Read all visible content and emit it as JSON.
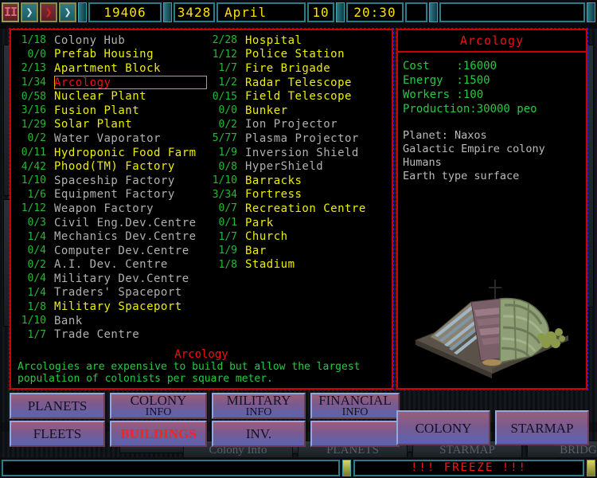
{
  "header": {
    "pause_label": "II",
    "arrow1": "❯",
    "arrow2": "❯",
    "arrow3": "❯",
    "credits": "19406",
    "year": "3428",
    "month": "April",
    "day": "10",
    "clock": "20:30"
  },
  "buildings": {
    "column_a": [
      {
        "count": "1/18",
        "name": "Colony Hub",
        "state": "grey"
      },
      {
        "count": "0/0",
        "name": "Prefab Housing",
        "state": "yellow"
      },
      {
        "count": "2/13",
        "name": "Apartment Block",
        "state": "yellow"
      },
      {
        "count": "1/34",
        "name": "Arcology",
        "state": "sel"
      },
      {
        "count": "0/58",
        "name": "Nuclear Plant",
        "state": "yellow"
      },
      {
        "count": "3/16",
        "name": "Fusion Plant",
        "state": "yellow"
      },
      {
        "count": "1/29",
        "name": "Solar Plant",
        "state": "yellow"
      },
      {
        "count": "0/2",
        "name": "Water Vaporator",
        "state": "grey"
      },
      {
        "count": "0/11",
        "name": "Hydroponic Food Farm",
        "state": "yellow"
      },
      {
        "count": "4/42",
        "name": "Phood(TM) Factory",
        "state": "yellow"
      },
      {
        "count": "1/10",
        "name": "Spaceship Factory",
        "state": "grey"
      },
      {
        "count": "1/6",
        "name": "Equipment Factory",
        "state": "grey"
      },
      {
        "count": "1/12",
        "name": "Weapon Factory",
        "state": "grey"
      },
      {
        "count": "0/3",
        "name": "Civil Eng.Dev.Centre",
        "state": "grey"
      },
      {
        "count": "1/4",
        "name": "Mechanics Dev.Centre",
        "state": "grey"
      },
      {
        "count": "0/4",
        "name": "Computer Dev.Centre",
        "state": "grey"
      },
      {
        "count": "0/2",
        "name": "A.I. Dev. Centre",
        "state": "grey"
      },
      {
        "count": "0/4",
        "name": "Military Dev.Centre",
        "state": "grey"
      },
      {
        "count": "1/4",
        "name": "Traders' Spaceport",
        "state": "grey"
      },
      {
        "count": "1/8",
        "name": "Military Spaceport",
        "state": "yellow"
      },
      {
        "count": "1/10",
        "name": "Bank",
        "state": "grey"
      },
      {
        "count": "1/7",
        "name": "Trade Centre",
        "state": "grey"
      }
    ],
    "column_b": [
      {
        "count": "2/28",
        "name": "Hospital",
        "state": "yellow"
      },
      {
        "count": "1/12",
        "name": "Police Station",
        "state": "yellow"
      },
      {
        "count": "1/7",
        "name": "Fire Brigade",
        "state": "yellow"
      },
      {
        "count": "1/2",
        "name": "Radar Telescope",
        "state": "yellow"
      },
      {
        "count": "0/15",
        "name": "Field Telescope",
        "state": "yellow"
      },
      {
        "count": "0/0",
        "name": "Bunker",
        "state": "yellow"
      },
      {
        "count": "0/2",
        "name": "Ion Projector",
        "state": "grey"
      },
      {
        "count": "5/77",
        "name": "Plasma Projector",
        "state": "grey"
      },
      {
        "count": "1/9",
        "name": "Inversion Shield",
        "state": "grey"
      },
      {
        "count": "0/8",
        "name": "HyperShield",
        "state": "grey"
      },
      {
        "count": "1/10",
        "name": "Barracks",
        "state": "yellow"
      },
      {
        "count": "3/34",
        "name": "Fortress",
        "state": "yellow"
      },
      {
        "count": "0/7",
        "name": "Recreation Centre",
        "state": "yellow"
      },
      {
        "count": "0/1",
        "name": "Park",
        "state": "yellow"
      },
      {
        "count": "1/7",
        "name": "Church",
        "state": "yellow"
      },
      {
        "count": "1/9",
        "name": "Bar",
        "state": "yellow"
      },
      {
        "count": "1/8",
        "name": "Stadium",
        "state": "yellow"
      }
    ]
  },
  "description": {
    "title": "Arcology",
    "body": "Arcologies are expensive to build but allow the largest\npopulation of colonists per square meter."
  },
  "info": {
    "title": "Arcology",
    "stats": "Cost    :16000\nEnergy  :1500\nWorkers :100\nProduction:30000 peo",
    "planet": "Planet: Naxos\nGalactic Empire colony\nHumans\nEarth type surface",
    "art_name": "arcology-isometric-render"
  },
  "buttons": {
    "planets": "PLANETS",
    "colony_info_l1": "COLONY",
    "colony_info_l2": "INFO",
    "military_info_l1": "MILITARY",
    "military_info_l2": "INFO",
    "financial_info_l1": "FINANCIAL",
    "financial_info_l2": "INFO",
    "fleets": "FLEETS",
    "buildings": "BUILDINGS",
    "inv": "INV.",
    "empty": "",
    "colony": "COLONY",
    "starmap": "STARMAP"
  },
  "ghost_buttons": [
    "Colony Info",
    "PLANETS",
    "STARMAP",
    "BRIDGE"
  ],
  "statusbar": {
    "left_text": "",
    "freeze": "!!! FREEZE !!!"
  },
  "colors": {
    "accent_red": "#cc0000",
    "list_yellow": "#eeee00",
    "list_grey": "#b0b0b0",
    "count_green": "#22bb33",
    "stat_green": "#22cc44",
    "select_orange": "#ee9900",
    "panel_teal": "#2e7a86",
    "field_yellow": "#ffe000"
  }
}
